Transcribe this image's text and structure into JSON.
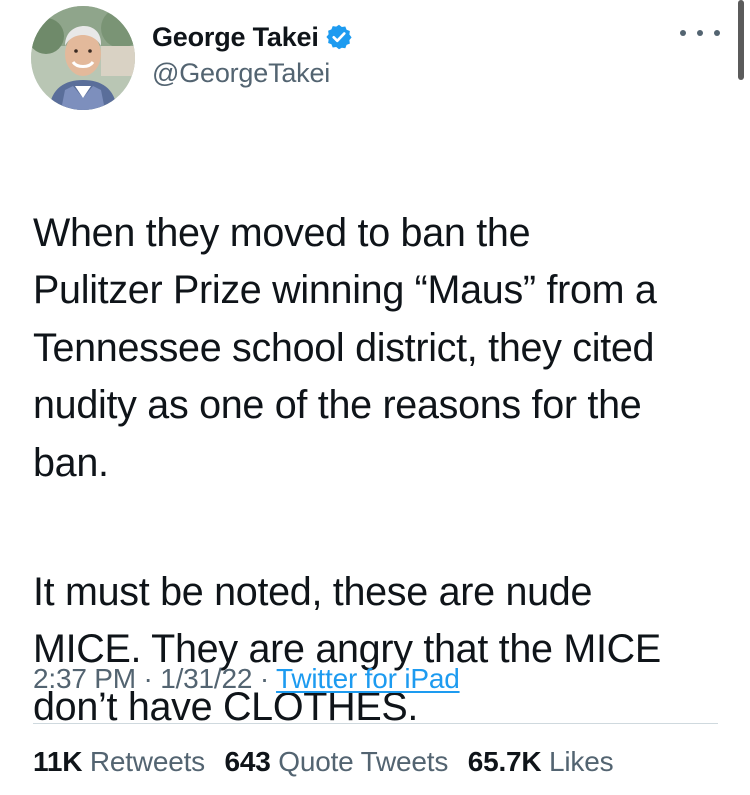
{
  "author": {
    "display_name": "George Takei",
    "handle": "@GeorgeTakei",
    "verified": true,
    "avatar_icon": "profile-photo"
  },
  "tweet": {
    "paragraphs": [
      "When they moved to ban the\nPulitzer Prize winning “Maus” from a\nTennessee school district, they cited\nnudity as one of the reasons for the\nban.",
      "It must be noted, these are nude\nMICE. They are angry that the MICE\ndon’t have CLOTHES."
    ],
    "time": "2:37 PM",
    "date": "1/31/22",
    "separator": "·",
    "source": "Twitter for iPad"
  },
  "stats": {
    "retweets": {
      "count": "11K",
      "label": "Retweets"
    },
    "quote_tweets": {
      "count": "643",
      "label": "Quote Tweets"
    },
    "likes": {
      "count": "65.7K",
      "label": "Likes"
    }
  },
  "colors": {
    "text": "#0f1419",
    "secondary": "#536471",
    "accent": "#1d9bf0",
    "divider": "#cfd9de"
  },
  "icons": {
    "verified": "verified-badge-icon",
    "more": "more-options-icon"
  }
}
